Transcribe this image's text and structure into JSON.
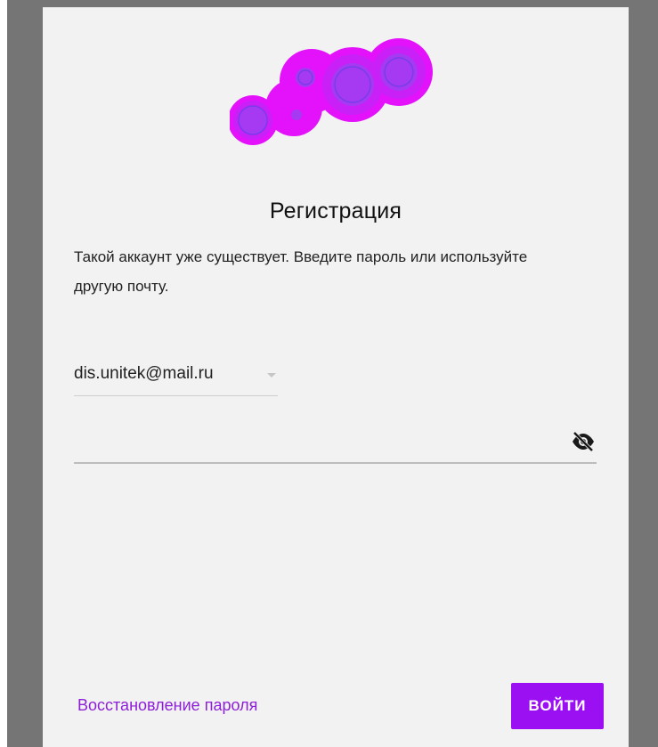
{
  "colors": {
    "overlay": "#757575",
    "card_background": "#f2f2f2",
    "accent": "#9b10f2",
    "link": "#8d1fd6",
    "logo_gradient": [
      "#d400ff",
      "#9a3cf5"
    ]
  },
  "logo": {
    "icon": "bubbles-logo-icon"
  },
  "registration": {
    "title": "Регистрация",
    "message": "Такой аккаунт уже существует. Введите пароль или используйте другую почту."
  },
  "email_select": {
    "value": "dis.unitek@mail.ru",
    "icon": "chevron-down-icon"
  },
  "password": {
    "value": "",
    "placeholder": "",
    "toggle_icon": "eye-off-icon"
  },
  "footer": {
    "forgot_password_label": "Восстановление пароля",
    "login_label": "ВОЙТИ"
  }
}
